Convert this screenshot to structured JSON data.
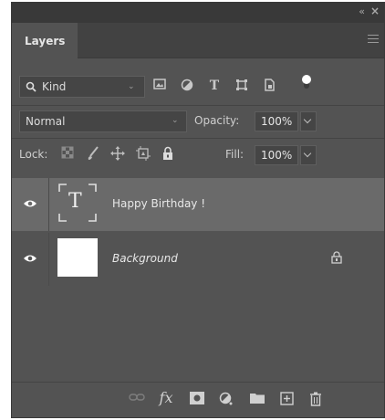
{
  "panel": {
    "title_tab": "Layers",
    "collapse_glyph": "«",
    "close_glyph": "×"
  },
  "filter": {
    "kind_label": "Kind",
    "icons": [
      "search-icon",
      "image-filter-icon",
      "adjustment-filter-icon",
      "type-filter-icon",
      "shape-filter-icon",
      "smart-object-filter-icon",
      "filter-toggle"
    ]
  },
  "blend": {
    "mode": "Normal",
    "opacity_label": "Opacity:",
    "opacity_value": "100%"
  },
  "lock": {
    "label": "Lock:",
    "fill_label": "Fill:",
    "fill_value": "100%",
    "icons": [
      "lock-transparent-pixels-icon",
      "lock-image-pixels-icon",
      "lock-position-icon",
      "lock-artboard-icon",
      "lock-all-icon"
    ]
  },
  "layers": [
    {
      "name": "Happy Birthday !",
      "type": "text",
      "visible": true,
      "selected": true,
      "thumb_glyph": "T"
    },
    {
      "name": "Background",
      "type": "pixel",
      "visible": true,
      "selected": false,
      "locked": true
    }
  ],
  "bottom_icons": [
    "link-layers-icon",
    "fx-icon",
    "add-mask-icon",
    "adjustment-layer-icon",
    "new-group-icon",
    "new-layer-icon",
    "delete-layer-icon"
  ],
  "bottom_labels": {
    "fx": "fx"
  },
  "colors": {
    "panel_bg": "#535353",
    "tab_bar_bg": "#424242",
    "selected_layer_bg": "#6a6a6a",
    "text": "#cfcfcf"
  }
}
